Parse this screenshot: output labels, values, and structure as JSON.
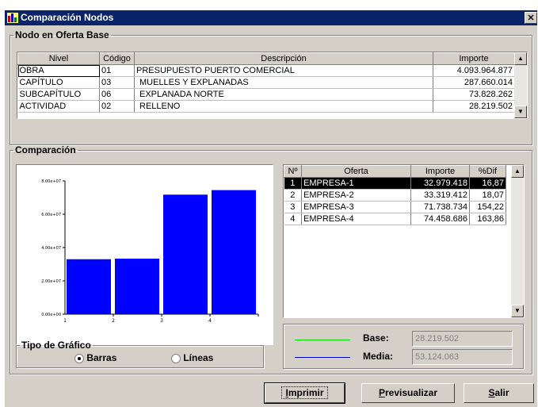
{
  "window": {
    "title": "Comparación Nodos",
    "close_glyph": "✕"
  },
  "nodo": {
    "legend": "Nodo en Oferta Base",
    "columns": [
      "Nivel",
      "Código",
      "Descripción",
      "Importe"
    ],
    "rows": [
      [
        "OBRA",
        "01",
        "PRESUPUESTO PUERTO COMERCIAL",
        "4.093.964.877"
      ],
      [
        "CAPÍTULO",
        "03",
        "MUELLES Y EXPLANADAS",
        "287.660.014"
      ],
      [
        "SUBCAPÍTULO",
        "06",
        "EXPLANADA NORTE",
        "73.828.262"
      ],
      [
        "ACTIVIDAD",
        "02",
        "RELLENO",
        "28.219.502"
      ]
    ]
  },
  "comparacion": {
    "legend": "Comparación",
    "columns": [
      "Nº",
      "Oferta",
      "Importe",
      "%Dif"
    ],
    "rows": [
      [
        "1",
        "EMPRESA-1",
        "32.979.418",
        "16,87"
      ],
      [
        "2",
        "EMPRESA-2",
        "33.319.412",
        "18,07"
      ],
      [
        "3",
        "EMPRESA-3",
        "71.738.734",
        "154,22"
      ],
      [
        "4",
        "EMPRESA-4",
        "74.458.686",
        "163,86"
      ]
    ],
    "base_label": "Base:",
    "base_value": "28.219.502",
    "media_label": "Media:",
    "media_value": "53.124.063",
    "base_line_color": "#00e000",
    "media_line_color": "#0000c0"
  },
  "chart_data": {
    "type": "bar",
    "categories": [
      "1",
      "2",
      "3",
      "4"
    ],
    "values": [
      32979418,
      33319412,
      71738734,
      74458686
    ],
    "ylim": [
      0,
      80000000
    ],
    "yticks": [
      "0.00e+00",
      "2.00e+07",
      "4.00e+07",
      "6.00e+07",
      "8.00e+07"
    ],
    "bar_color": "#0000ff",
    "grid": false
  },
  "tipo": {
    "legend": "Tipo de Gráfico",
    "barras": "Barras",
    "lineas": "Líneas",
    "selected": "Barras"
  },
  "buttons": {
    "imprimir_first": "I",
    "imprimir_rest": "mprimir",
    "previsualizar_first": "P",
    "previsualizar_rest": "revisualizar",
    "salir_first": "S",
    "salir_rest": "alir"
  }
}
